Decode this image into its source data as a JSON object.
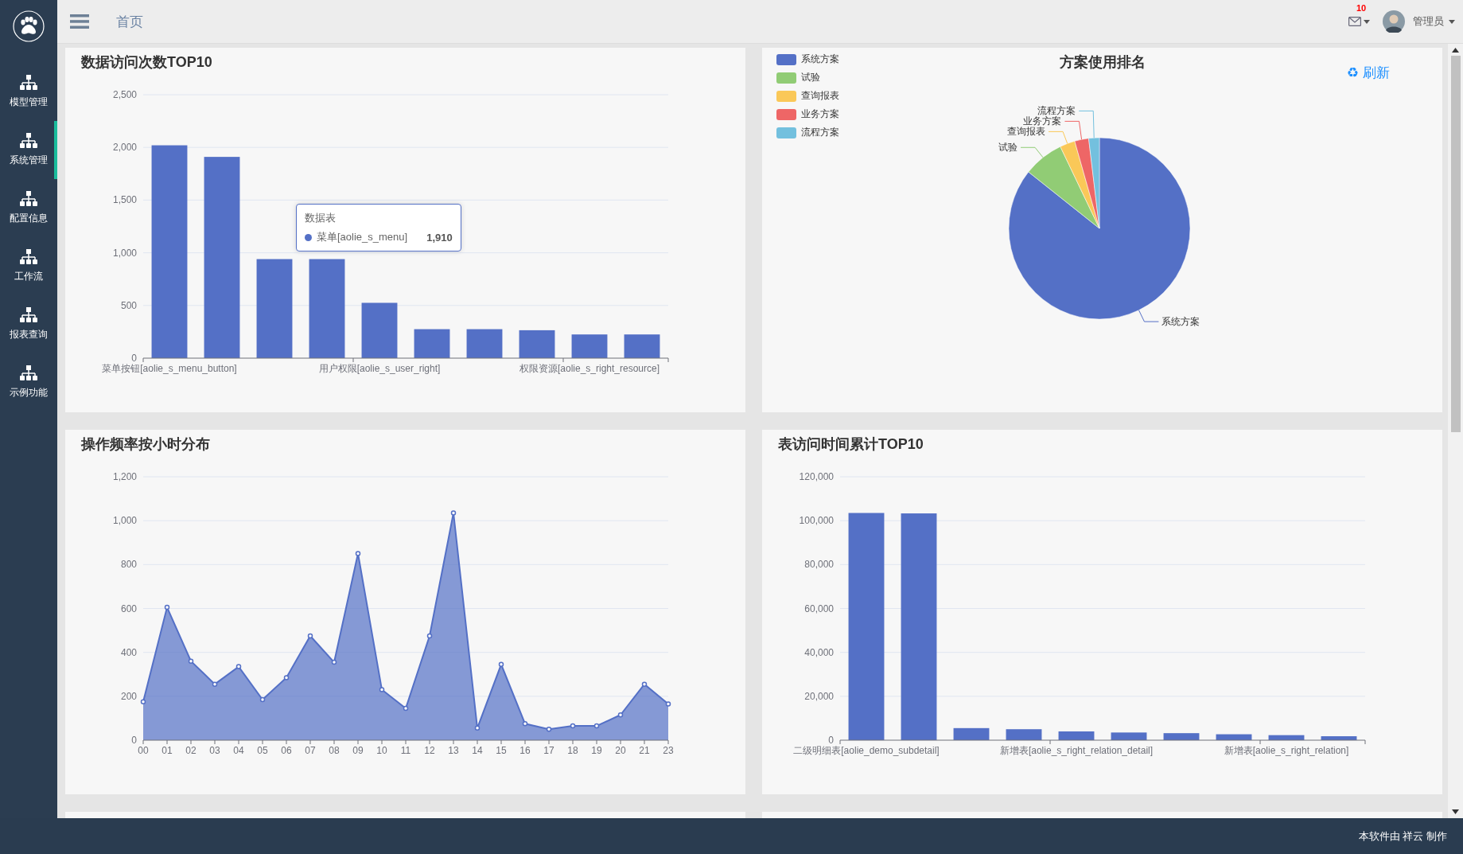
{
  "sidebar": {
    "items": [
      {
        "label": "模型管理",
        "selected": false
      },
      {
        "label": "系统管理",
        "selected": true
      },
      {
        "label": "配置信息",
        "selected": false
      },
      {
        "label": "工作流",
        "selected": false
      },
      {
        "label": "报表查询",
        "selected": false
      },
      {
        "label": "示例功能",
        "selected": false
      }
    ]
  },
  "header": {
    "breadcrumb": "首页",
    "mail_badge": "10",
    "user": "管理员"
  },
  "panels": [
    {
      "kind": "bar",
      "title": "数据访问次数TOP10",
      "tooltip": {
        "series": "数据表",
        "category": "菜单[aolie_s_menu]",
        "value": "1,910"
      },
      "chart_data": {
        "type": "bar",
        "categories": [
          "菜单按钮[aolie_s_menu_button]",
          null,
          null,
          null,
          "用户权限[aolie_s_user_right]",
          null,
          null,
          null,
          "权限资源[aolie_s_right_resource]",
          null
        ],
        "series": [
          {
            "color": "#5470c6",
            "values": [
              2020,
              1910,
              940,
              940,
              525,
              275,
              275,
              265,
              225,
              225
            ]
          }
        ],
        "grid": true,
        "ylim": [
          0,
          2500
        ],
        "yticks": [
          0,
          500,
          {
            "value": 1000,
            "label": "1,000"
          },
          {
            "value": 1500,
            "label": "1,500"
          },
          {
            "value": 2000,
            "label": "2,000"
          },
          {
            "value": 2500,
            "label": "2,500"
          }
        ]
      }
    },
    {
      "kind": "pie",
      "title": "方案使用排名",
      "refresh": {
        "icon": "♻",
        "label": "刷新"
      },
      "legend": [
        {
          "label": "系统方案",
          "color": "#5470c6"
        },
        {
          "label": "试验",
          "color": "#91cc75"
        },
        {
          "label": "查询报表",
          "color": "#fac858"
        },
        {
          "label": "业务方案",
          "color": "#ee6666"
        },
        {
          "label": "流程方案",
          "color": "#73c0de"
        }
      ],
      "chart_data": {
        "type": "pie",
        "categories": [
          "系统方案",
          "试验",
          "查询报表",
          "业务方案",
          "流程方案"
        ],
        "values": [
          85.7,
          7.2,
          2.7,
          2.5,
          1.9
        ]
      }
    },
    {
      "kind": "line",
      "title": "操作频率按小时分布",
      "chart_data": {
        "type": "area",
        "categories": [
          "00",
          "01",
          "02",
          "03",
          "04",
          "05",
          "06",
          "07",
          "08",
          "09",
          "10",
          "11",
          "12",
          "13",
          "14",
          "15",
          "16",
          "17",
          "18",
          "19",
          "20",
          "21",
          "23"
        ],
        "grid": true,
        "series": [
          {
            "color": "#5470c6",
            "values": [
              175,
              605,
              360,
              255,
              335,
              185,
              285,
              475,
              355,
              850,
              230,
              145,
              475,
              1035,
              55,
              345,
              75,
              50,
              65,
              65,
              115,
              255,
              165
            ]
          }
        ],
        "ylim": [
          0,
          1200
        ],
        "yticks": [
          0,
          200,
          400,
          600,
          800,
          {
            "value": 1000,
            "label": "1,000"
          },
          {
            "value": 1200,
            "label": "1,200"
          }
        ]
      }
    },
    {
      "kind": "bar",
      "title": "表访问时间累计TOP10",
      "chart_data": {
        "type": "bar",
        "categories": [
          "二级明细表[aolie_demo_subdetail]",
          null,
          null,
          null,
          "新增表[aolie_s_right_relation_detail]",
          null,
          null,
          null,
          "新增表[aolie_s_right_relation]",
          null
        ],
        "grid": true,
        "series": [
          {
            "color": "#5470c6",
            "values": [
              103500,
              103300,
              5500,
              5000,
              4000,
              3500,
              3200,
              2700,
              2300,
              1800
            ]
          }
        ],
        "ylim": [
          0,
          120000
        ],
        "yticks": [
          0,
          {
            "value": 20000,
            "label": "20,000"
          },
          {
            "value": 40000,
            "label": "40,000"
          },
          {
            "value": 60000,
            "label": "60,000"
          },
          {
            "value": 80000,
            "label": "80,000"
          },
          {
            "value": 100000,
            "label": "100,000"
          },
          {
            "value": 120000,
            "label": "120,000"
          }
        ]
      }
    }
  ],
  "footer": "本软件由 祥云 制作"
}
